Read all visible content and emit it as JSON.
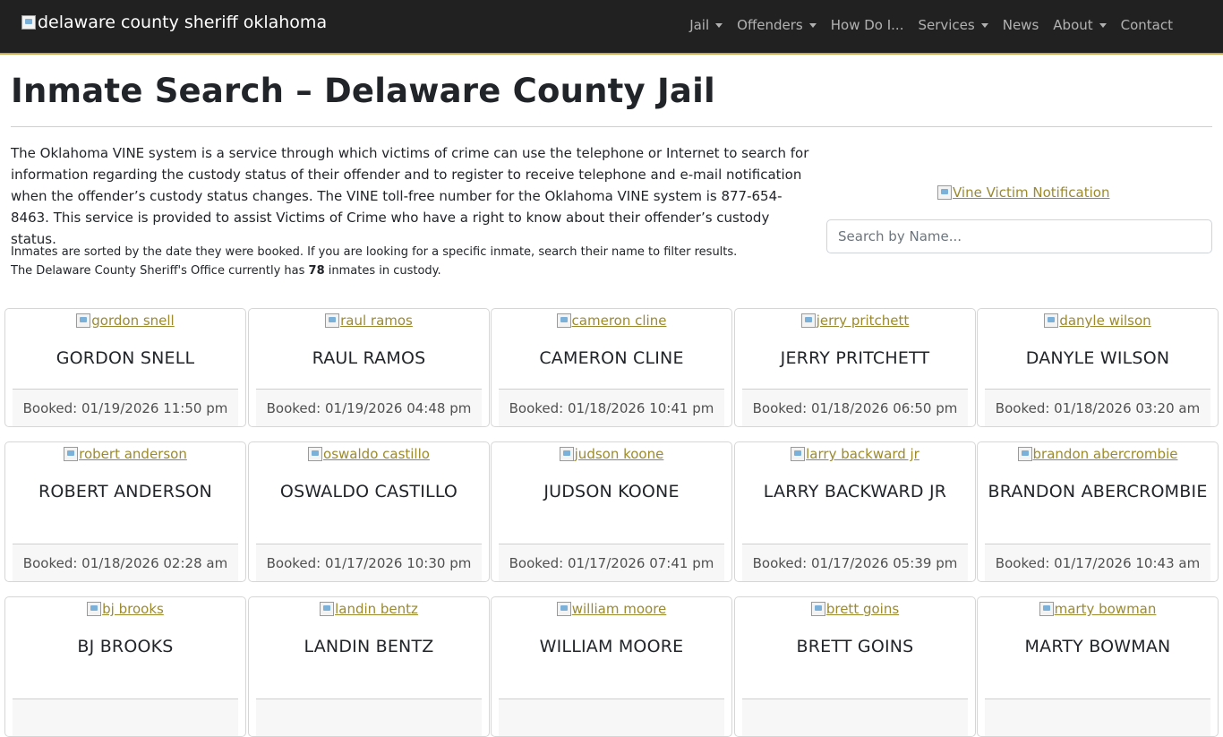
{
  "header": {
    "brand_alt": "delaware county sheriff oklahoma",
    "nav": [
      {
        "label": "Jail",
        "dropdown": true
      },
      {
        "label": "Offenders",
        "dropdown": true
      },
      {
        "label": "How Do I...",
        "dropdown": false
      },
      {
        "label": "Services",
        "dropdown": true
      },
      {
        "label": "News",
        "dropdown": false
      },
      {
        "label": "About",
        "dropdown": true
      },
      {
        "label": "Contact",
        "dropdown": false
      }
    ]
  },
  "main": {
    "title": "Inmate Search – Delaware County Jail",
    "intro": "The Oklahoma VINE system is a service through which victims of crime can use the telephone or Internet to search for information regarding the custody status of their offender and to register to receive telephone and e-mail notification when the offender’s custody status changes. The VINE toll-free number for the Oklahoma VINE system is 877-654-8463. This service is provided to assist Victims of Crime who have a right to know about their offender’s custody status.",
    "note_line1": "Inmates are sorted by the date they were booked. If you are looking for a specific inmate, search their name to filter results.",
    "note_line2_prefix": "The Delaware County Sheriff's Office currently has ",
    "inmate_count": "78",
    "note_line2_suffix": " inmates in custody.",
    "vine_alt": "Vine Victim Notification",
    "search_placeholder": "Search by Name..."
  },
  "inmates": [
    {
      "alt": "gordon snell",
      "name": "GORDON SNELL",
      "booked": "Booked: 01/19/2026 11:50 pm"
    },
    {
      "alt": "raul ramos",
      "name": "RAUL RAMOS",
      "booked": "Booked: 01/19/2026 04:48 pm"
    },
    {
      "alt": "cameron cline",
      "name": "CAMERON CLINE",
      "booked": "Booked: 01/18/2026 10:41 pm"
    },
    {
      "alt": "jerry pritchett",
      "name": "JERRY PRITCHETT",
      "booked": "Booked: 01/18/2026 06:50 pm"
    },
    {
      "alt": "danyle wilson",
      "name": "DANYLE WILSON",
      "booked": "Booked: 01/18/2026 03:20 am"
    },
    {
      "alt": "robert anderson",
      "name": "ROBERT ANDERSON",
      "booked": "Booked: 01/18/2026 02:28 am"
    },
    {
      "alt": "oswaldo castillo",
      "name": "OSWALDO CASTILLO",
      "booked": "Booked: 01/17/2026 10:30 pm"
    },
    {
      "alt": "judson koone",
      "name": "JUDSON KOONE",
      "booked": "Booked: 01/17/2026 07:41 pm"
    },
    {
      "alt": "larry backward jr",
      "name": "LARRY BACKWARD JR",
      "booked": "Booked: 01/17/2026 05:39 pm"
    },
    {
      "alt": "brandon abercrombie",
      "name": "BRANDON ABERCROMBIE",
      "booked": "Booked: 01/17/2026 10:43 am"
    },
    {
      "alt": "bj brooks",
      "name": "BJ BROOKS",
      "booked": ""
    },
    {
      "alt": "landin bentz",
      "name": "LANDIN BENTZ",
      "booked": ""
    },
    {
      "alt": "william moore",
      "name": "WILLIAM MOORE",
      "booked": ""
    },
    {
      "alt": "brett goins",
      "name": "BRETT GOINS",
      "booked": ""
    },
    {
      "alt": "marty bowman",
      "name": "MARTY BOWMAN",
      "booked": ""
    }
  ]
}
